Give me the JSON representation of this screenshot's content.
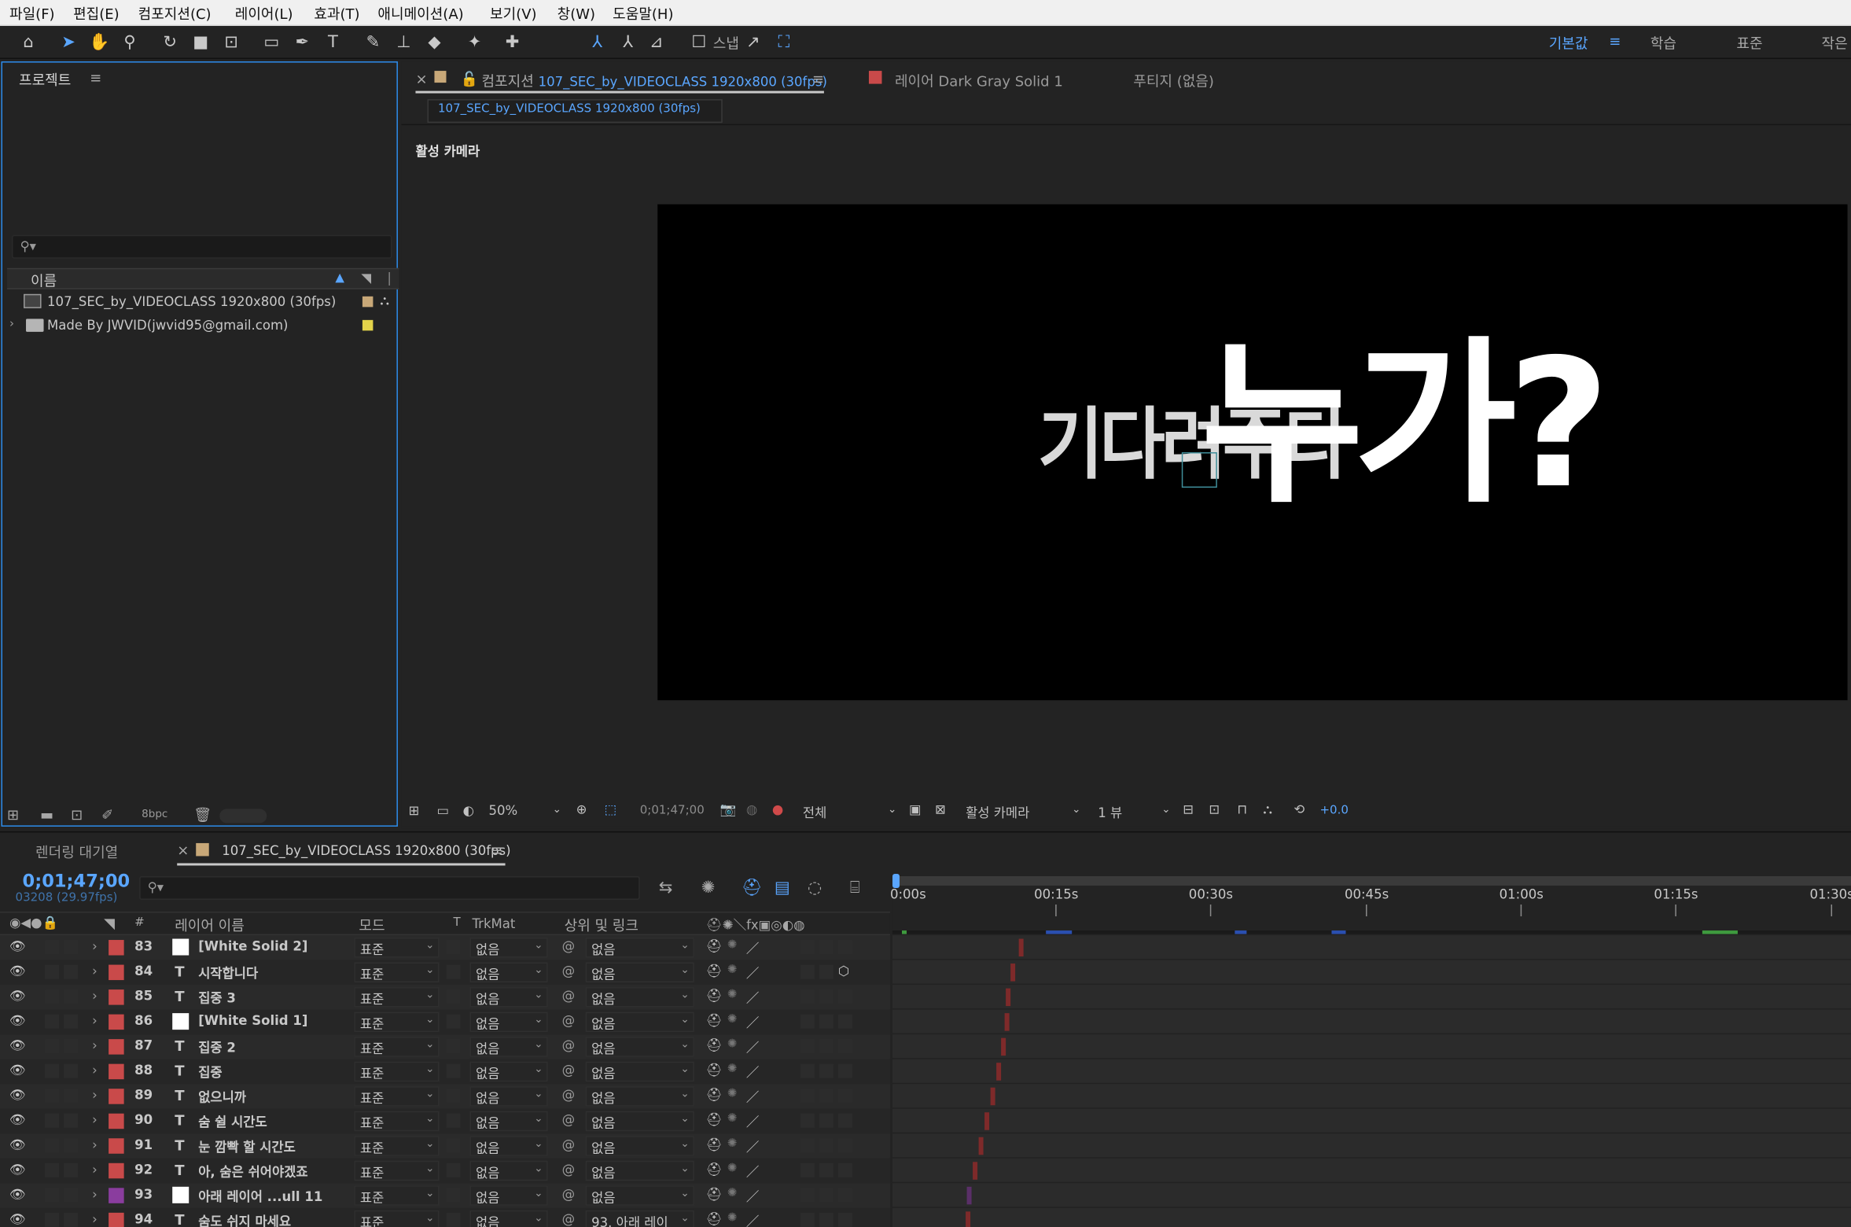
{
  "menu": [
    "파일(F)",
    "편집(E)",
    "컴포지션(C)",
    "레이어(L)",
    "효과(T)",
    "애니메이션(A)",
    "보기(V)",
    "창(W)",
    "도움말(H)"
  ],
  "toolbar": {
    "snap_label": "스냅",
    "workspaces": [
      "기본값",
      "학습",
      "표준",
      "작은"
    ],
    "active_workspace": "기본값"
  },
  "project": {
    "title": "프로젝트",
    "col_name": "이름",
    "items": [
      {
        "name": "107_SEC_by_VIDEOCLASS 1920x800 (30fps)",
        "type": "composition"
      },
      {
        "name": "Made By JWVID(jwvid95@gmail.com)",
        "type": "folder"
      }
    ],
    "bpc": "8bpc"
  },
  "viewer": {
    "comp_tab_prefix": "컴포지션",
    "comp_tab_name": "107_SEC_by_VIDEOCLASS 1920x800 (30fps)",
    "layer_tab": "레이어 Dark Gray Solid 1",
    "footage_tab": "푸티지 (없음)",
    "subtab": "107_SEC_by_VIDEOCLASS 1920x800 (30fps)",
    "camera_label": "활성 카메라",
    "text_back": "기다려주다",
    "text_front": "누가?",
    "zoom": "50%",
    "timecode": "0;01;47;00",
    "resolution": "전체",
    "camera_select": "활성 카메라",
    "views": "1 뷰",
    "exposure": "+0.0"
  },
  "timeline": {
    "render_queue_tab": "렌더링 대기열",
    "comp_tab": "107_SEC_by_VIDEOCLASS 1920x800 (30fps)",
    "timecode": "0;01;47;00",
    "frame_info": "03208 (29.97fps)",
    "headers": {
      "num": "#",
      "name": "레이어 이름",
      "mode": "모드",
      "t": "T",
      "trkmat": "TrkMat",
      "parent": "상위 및 링크"
    },
    "ruler": [
      "0:00s",
      "00:15s",
      "00:30s",
      "00:45s",
      "01:00s",
      "01:15s",
      "01:30s"
    ],
    "layers": [
      {
        "num": "83",
        "kind": "solid",
        "name": "[White Solid 2]",
        "mode": "표준",
        "trkmat": "없음",
        "parent": "없음",
        "color": "#c94a4a",
        "bar": 863
      },
      {
        "num": "84",
        "kind": "text",
        "name": "시작합니다",
        "mode": "표준",
        "trkmat": "없음",
        "parent": "없음",
        "color": "#c94a4a",
        "bar": 856
      },
      {
        "num": "85",
        "kind": "text",
        "name": "집중 3",
        "mode": "표준",
        "trkmat": "없음",
        "parent": "없음",
        "color": "#c94a4a",
        "bar": 852
      },
      {
        "num": "86",
        "kind": "solid",
        "name": "[White Solid 1]",
        "mode": "표준",
        "trkmat": "없음",
        "parent": "없음",
        "color": "#c94a4a",
        "bar": 851
      },
      {
        "num": "87",
        "kind": "text",
        "name": "집중 2",
        "mode": "표준",
        "trkmat": "없음",
        "parent": "없음",
        "color": "#c94a4a",
        "bar": 848
      },
      {
        "num": "88",
        "kind": "text",
        "name": "집중",
        "mode": "표준",
        "trkmat": "없음",
        "parent": "없음",
        "color": "#c94a4a",
        "bar": 844
      },
      {
        "num": "89",
        "kind": "text",
        "name": "없으니까",
        "mode": "표준",
        "trkmat": "없음",
        "parent": "없음",
        "color": "#c94a4a",
        "bar": 839
      },
      {
        "num": "90",
        "kind": "text",
        "name": "숨 쉴 시간도",
        "mode": "표준",
        "trkmat": "없음",
        "parent": "없음",
        "color": "#c94a4a",
        "bar": 834
      },
      {
        "num": "91",
        "kind": "text",
        "name": "눈 깜빡 할 시간도",
        "mode": "표준",
        "trkmat": "없음",
        "parent": "없음",
        "color": "#c94a4a",
        "bar": 829
      },
      {
        "num": "92",
        "kind": "text",
        "name": "아, 숨은 쉬어야겠죠",
        "mode": "표준",
        "trkmat": "없음",
        "parent": "없음",
        "color": "#c94a4a",
        "bar": 824
      },
      {
        "num": "93",
        "kind": "solid",
        "name": "아래 레이어 ...ull 11",
        "mode": "표준",
        "trkmat": "없음",
        "parent": "없음",
        "color": "#8a3d9e",
        "bar": 819
      },
      {
        "num": "94",
        "kind": "text",
        "name": "숨도 쉬지 마세요",
        "mode": "표준",
        "trkmat": "없음",
        "parent": "93. 아래 레이",
        "color": "#c94a4a",
        "bar": 818
      }
    ]
  },
  "colors": {
    "accent": "#2d8ceb",
    "label_red": "#c94a4a",
    "label_purple": "#8a3d9e"
  }
}
